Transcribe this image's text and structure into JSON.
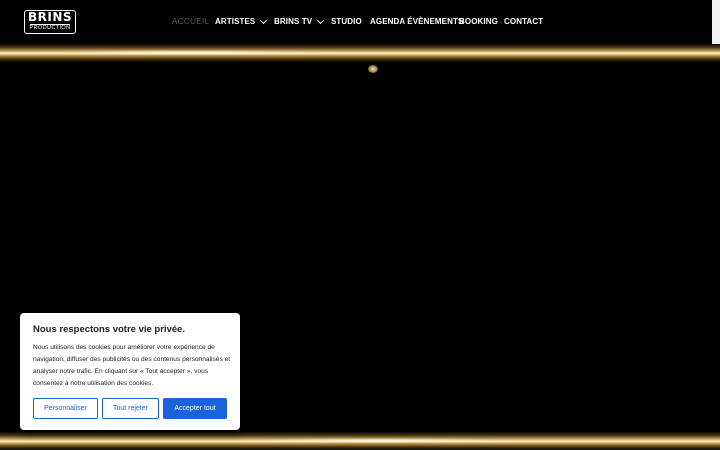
{
  "logo": {
    "brand": "BRINS",
    "subtitle": "PRODUCTION"
  },
  "nav": {
    "items": [
      {
        "label": "ACCUEIL",
        "active": true
      },
      {
        "label": "ARTISTES",
        "has_submenu": true
      },
      {
        "label": "BRINS TV",
        "has_submenu": true
      },
      {
        "label": "STUDIO"
      },
      {
        "label": "AGENDA ÉVÈNEMENTS"
      },
      {
        "label": "BOOKING"
      },
      {
        "label": "CONTACT"
      }
    ]
  },
  "cookie_banner": {
    "title": "Nous respectons votre vie privée.",
    "message": "Nous utilisons des cookies pour améliorer votre expérience de navigation, diffuser des publicités ou des contenus personnalisés et analyser notre trafic. En cliquant sur « Tout accepter », vous consentez à notre utilisation des cookies.",
    "buttons": {
      "customize": "Personnaliser",
      "reject": "Tout rejeter",
      "accept": "Accepter tout"
    }
  },
  "colors": {
    "background": "#000000",
    "accent_blue": "#1863dc",
    "gold": "#c9a45a",
    "nav_active": "#4f5b67"
  },
  "icons": {
    "submenu": "chevron-down-icon"
  }
}
